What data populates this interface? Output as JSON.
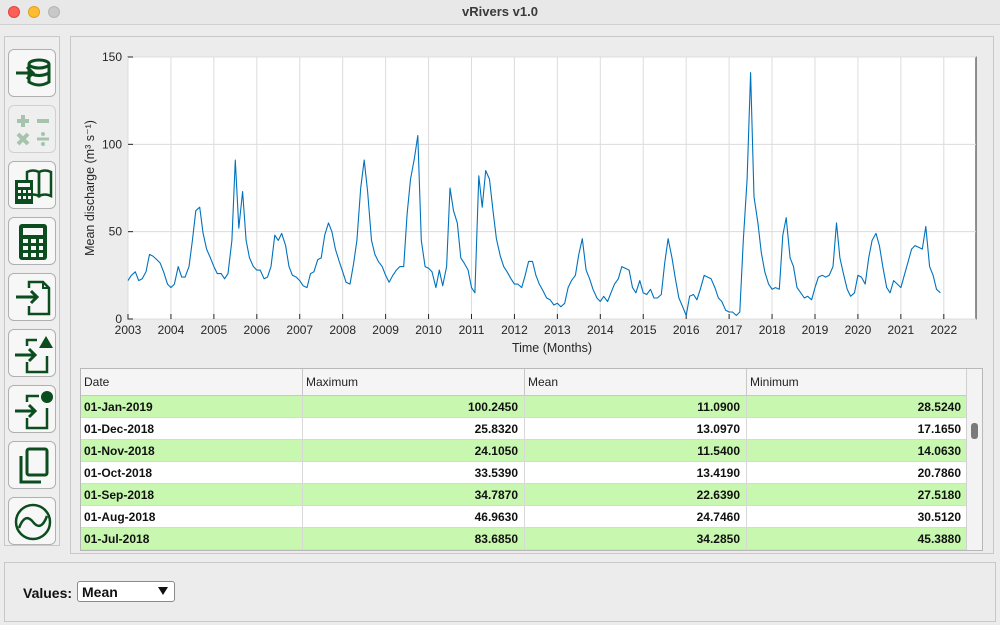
{
  "window": {
    "title": "vRivers v1.0"
  },
  "toolbar": {
    "buttons": [
      {
        "name": "import-database-button",
        "icon": "import-database-icon",
        "enabled": true
      },
      {
        "name": "arithmetic-button",
        "icon": "arithmetic-operators-icon",
        "enabled": false
      },
      {
        "name": "calculator-book-button",
        "icon": "calculator-book-icon",
        "enabled": true
      },
      {
        "name": "calculator-button",
        "icon": "calculator-icon",
        "enabled": true
      },
      {
        "name": "import-file-button",
        "icon": "import-file-icon",
        "enabled": true
      },
      {
        "name": "import-file-triangle-button",
        "icon": "import-file-triangle-icon",
        "enabled": true
      },
      {
        "name": "import-file-circle-button",
        "icon": "import-file-circle-icon",
        "enabled": true
      },
      {
        "name": "copy-button",
        "icon": "copy-icon",
        "enabled": true
      },
      {
        "name": "plot-button",
        "icon": "plot-icon",
        "enabled": true
      }
    ]
  },
  "chart_data": {
    "type": "line",
    "xlabel": "Time (Months)",
    "ylabel": "Mean discharge (m³ s⁻¹)",
    "ylim": [
      0,
      150
    ],
    "xlim": [
      2003,
      2022.75
    ],
    "yticks": [
      0,
      50,
      100,
      150
    ],
    "xticks": [
      "2003",
      "2004",
      "2005",
      "2006",
      "2007",
      "2008",
      "2009",
      "2010",
      "2011",
      "2012",
      "2013",
      "2014",
      "2015",
      "2016",
      "2017",
      "2018",
      "2019",
      "2020",
      "2021",
      "2022"
    ],
    "grid": true,
    "color": "#0072bd",
    "series": [
      {
        "x": [
          2003.0,
          2003.08,
          2003.17,
          2003.25,
          2003.33,
          2003.42,
          2003.5,
          2003.58,
          2003.67,
          2003.75,
          2003.83,
          2003.92,
          2004.0,
          2004.08,
          2004.17,
          2004.25,
          2004.33,
          2004.42,
          2004.5,
          2004.58,
          2004.67,
          2004.75,
          2004.83,
          2004.92,
          2005.0,
          2005.08,
          2005.17,
          2005.25,
          2005.33,
          2005.42,
          2005.5,
          2005.58,
          2005.67,
          2005.75,
          2005.83,
          2005.92,
          2006.0,
          2006.08,
          2006.17,
          2006.25,
          2006.33,
          2006.42,
          2006.5,
          2006.58,
          2006.67,
          2006.75,
          2006.83,
          2006.92,
          2007.0,
          2007.08,
          2007.17,
          2007.25,
          2007.33,
          2007.42,
          2007.5,
          2007.58,
          2007.67,
          2007.75,
          2007.83,
          2007.92,
          2008.0,
          2008.08,
          2008.17,
          2008.25,
          2008.33,
          2008.42,
          2008.5,
          2008.58,
          2008.67,
          2008.75,
          2008.83,
          2008.92,
          2009.0,
          2009.08,
          2009.17,
          2009.25,
          2009.33,
          2009.42,
          2009.5,
          2009.58,
          2009.67,
          2009.75,
          2009.83,
          2009.92,
          2010.0,
          2010.08,
          2010.17,
          2010.25,
          2010.33,
          2010.42,
          2010.5,
          2010.58,
          2010.67,
          2010.75,
          2010.83,
          2010.92,
          2011.0,
          2011.08,
          2011.17,
          2011.25,
          2011.33,
          2011.42,
          2011.5,
          2011.58,
          2011.67,
          2011.75,
          2011.83,
          2011.92,
          2012.0,
          2012.08,
          2012.17,
          2012.25,
          2012.33,
          2012.42,
          2012.5,
          2012.58,
          2012.67,
          2012.75,
          2012.83,
          2012.92,
          2013.0,
          2013.08,
          2013.17,
          2013.25,
          2013.33,
          2013.42,
          2013.5,
          2013.58,
          2013.67,
          2013.75,
          2013.83,
          2013.92,
          2014.0,
          2014.08,
          2014.17,
          2014.25,
          2014.33,
          2014.42,
          2014.5,
          2014.58,
          2014.67,
          2014.75,
          2014.83,
          2014.92,
          2015.0,
          2015.08,
          2015.17,
          2015.25,
          2015.33,
          2015.42,
          2015.5,
          2015.58,
          2015.67,
          2015.75,
          2015.83,
          2015.92,
          2016.0,
          2016.08,
          2016.17,
          2016.25,
          2016.33,
          2016.42,
          2016.5,
          2016.58,
          2016.67,
          2016.75,
          2016.83,
          2016.92,
          2017.0,
          2017.08,
          2017.17,
          2017.25,
          2017.33,
          2017.42,
          2017.5,
          2017.58,
          2017.67,
          2017.75,
          2017.83,
          2017.92,
          2018.0,
          2018.08,
          2018.17,
          2018.25,
          2018.33,
          2018.42,
          2018.5,
          2018.58,
          2018.67,
          2018.75,
          2018.83,
          2018.92,
          2019.0,
          2019.08,
          2019.17,
          2019.25,
          2019.33,
          2019.42,
          2019.5,
          2019.58,
          2019.67,
          2019.75,
          2019.83,
          2019.92,
          2020.0,
          2020.08,
          2020.17,
          2020.25,
          2020.33,
          2020.42,
          2020.5,
          2020.58,
          2020.67,
          2020.75,
          2020.83,
          2020.92,
          2021.0,
          2021.08,
          2021.17,
          2021.25,
          2021.33,
          2021.42,
          2021.5,
          2021.58,
          2021.67,
          2021.75,
          2021.83,
          2021.92
        ],
        "y": [
          22,
          25,
          27,
          22,
          23,
          27,
          37,
          36,
          34,
          32,
          27,
          20,
          18,
          20,
          30,
          24,
          24,
          30,
          45,
          62,
          64,
          49,
          40,
          35,
          30,
          26,
          26,
          23,
          26,
          45,
          91,
          52,
          73,
          45,
          35,
          30,
          28,
          28,
          23,
          24,
          30,
          48,
          45,
          49,
          42,
          30,
          25,
          24,
          22,
          19,
          18,
          26,
          27,
          34,
          35,
          48,
          55,
          50,
          40,
          33,
          27,
          21,
          20,
          31,
          45,
          75,
          91,
          73,
          45,
          37,
          33,
          30,
          25,
          21,
          25,
          28,
          30,
          30,
          60,
          80,
          92,
          105,
          45,
          30,
          29,
          27,
          18,
          28,
          19,
          30,
          75,
          62,
          55,
          35,
          32,
          28,
          18,
          15,
          82,
          64,
          85,
          80,
          62,
          46,
          36,
          30,
          27,
          23,
          20,
          20,
          18,
          25,
          33,
          33,
          25,
          20,
          16,
          12,
          11,
          8,
          9,
          7,
          9,
          18,
          22,
          25,
          37,
          46,
          28,
          23,
          17,
          12,
          10,
          13,
          10,
          15,
          20,
          23,
          30,
          29,
          28,
          18,
          15,
          22,
          15,
          14,
          17,
          12,
          12,
          14,
          32,
          46,
          35,
          23,
          12,
          7,
          2,
          13,
          14,
          11,
          17,
          25,
          24,
          23,
          18,
          12,
          10,
          5,
          4,
          4,
          2,
          4,
          45,
          80,
          141,
          70,
          55,
          38,
          27,
          20,
          17,
          18,
          17,
          48,
          58,
          35,
          30,
          18,
          15,
          12,
          13,
          11,
          18,
          24,
          25,
          24,
          25,
          30,
          55,
          35,
          25,
          17,
          13,
          15,
          25,
          24,
          20,
          35,
          45,
          49,
          42,
          30,
          18,
          15,
          22,
          20,
          18,
          25,
          33,
          40,
          42,
          41,
          40,
          53,
          30,
          25,
          17,
          15
        ]
      }
    ]
  },
  "table": {
    "columns": [
      "Date",
      "Maximum",
      "Mean",
      "Minimum"
    ],
    "rows": [
      [
        "01-Jan-2019",
        "100.2450",
        "11.0900",
        "28.5240"
      ],
      [
        "01-Dec-2018",
        "25.8320",
        "13.0970",
        "17.1650"
      ],
      [
        "01-Nov-2018",
        "24.1050",
        "11.5400",
        "14.0630"
      ],
      [
        "01-Oct-2018",
        "33.5390",
        "13.4190",
        "20.7860"
      ],
      [
        "01-Sep-2018",
        "34.7870",
        "22.6390",
        "27.5180"
      ],
      [
        "01-Aug-2018",
        "46.9630",
        "24.7460",
        "30.5120"
      ],
      [
        "01-Jul-2018",
        "83.6850",
        "34.2850",
        "45.3880"
      ]
    ],
    "highlight_color": "#c8f7b0"
  },
  "controls": {
    "values_label": "Values:",
    "values_selected": "Mean"
  }
}
